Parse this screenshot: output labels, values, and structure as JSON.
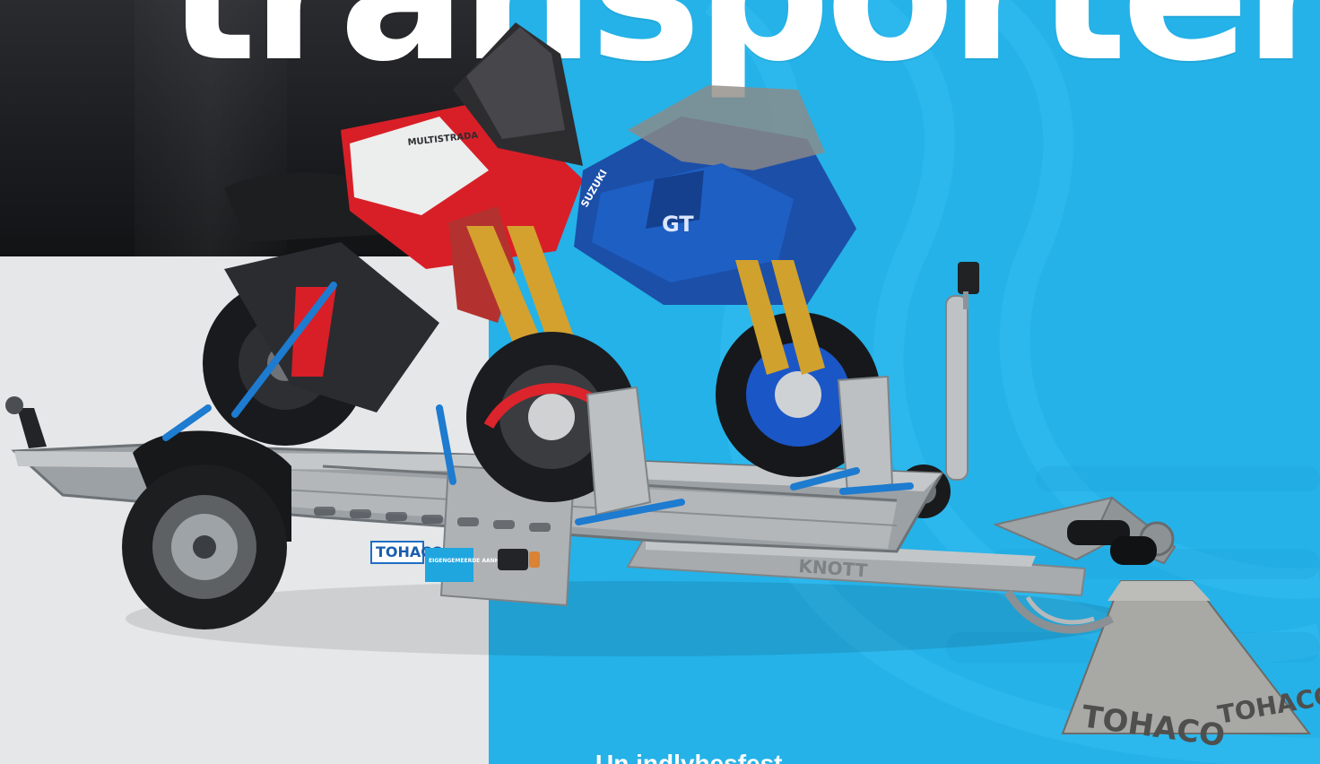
{
  "headline": {
    "text": "transporter"
  },
  "subtitle": {
    "text": "Un indlyhesfest"
  },
  "brand": {
    "label_primary": "TOHACO",
    "label_secondary": "TOHACO",
    "plate_text": "EIGENGEMEERDE AANHANGERS",
    "axle_brand": "KNOTT",
    "tank_brand": "MULTISTRADA",
    "fairing_brand": "SUZUKI",
    "fairing_model": "GT"
  },
  "colors": {
    "blue_panel": "#24b2e8",
    "light_panel": "#e6e7e9",
    "dark_panel": "#1c1d20",
    "motorcycle_red": "#d81f27",
    "motorcycle_blue": "#1c4fa8",
    "galvanized_steel": "#a9adb0",
    "strap_blue": "#1d7bd0"
  }
}
